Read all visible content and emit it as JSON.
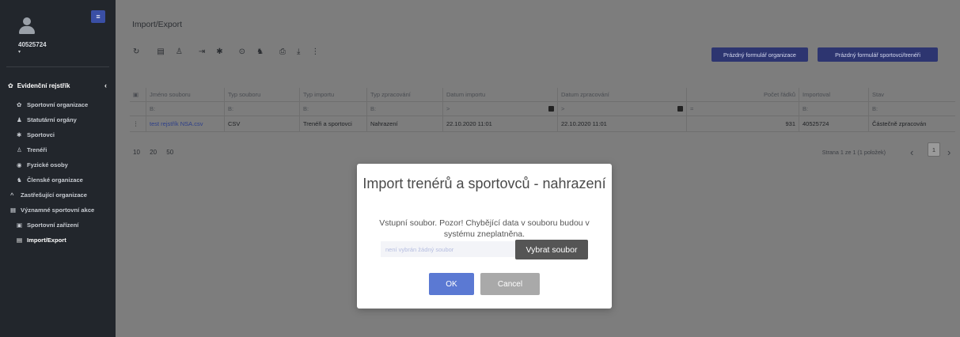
{
  "user": {
    "id": "40525724",
    "caret": "▾"
  },
  "sidebar": {
    "menu_icon": "≡",
    "section": {
      "label": "Evidenční rejstřík",
      "icon": "gear-icon",
      "chevron": "‹"
    },
    "items": [
      {
        "label": "Sportovní organizace",
        "icon": "gear-icon"
      },
      {
        "label": "Statutární orgány",
        "icon": "user-tie-icon"
      },
      {
        "label": "Sportovci",
        "icon": "runner-icon"
      },
      {
        "label": "Trenéři",
        "icon": "trainer-icon"
      },
      {
        "label": "Fyzické osoby",
        "icon": "person-circle-icon"
      },
      {
        "label": "Členské organizace",
        "icon": "users-icon"
      },
      {
        "label": "Zastřešující organizace",
        "icon": "chevron-up-icon"
      },
      {
        "label": "Významné sportovní akce",
        "icon": "calendar-icon"
      },
      {
        "label": "Sportovní zařízení",
        "icon": "building-icon"
      },
      {
        "label": "Import/Export",
        "icon": "file-import-icon"
      }
    ]
  },
  "header": {
    "title": "Import/Export"
  },
  "toolbar": {
    "icons": [
      "refresh-icon",
      "file-icon",
      "person-icon",
      "export-icon",
      "runner-icon",
      "help-icon",
      "users-icon",
      "print-icon",
      "download-icon",
      "more-icon"
    ],
    "btn_org": "Prázdný formulář organizace",
    "btn_sport": "Prázdný formulář sportovci/trenéři"
  },
  "table": {
    "headers": [
      "Jméno souboru",
      "Typ souboru",
      "Typ importu",
      "Typ zpracování",
      "Datum importu",
      "Datum zpracování",
      "Počet řádků",
      "Importoval",
      "Stav"
    ],
    "filters": [
      "B:",
      "B:",
      "B:",
      "B:",
      ">",
      ">",
      "=",
      "B:",
      "B:"
    ],
    "rows": [
      {
        "menu": "⋮",
        "file": "test rejstřík NSA.csv",
        "type": "CSV",
        "import_type": "Trenéři a sportovci",
        "processing": "Nahrazení",
        "import_date": "22.10.2020 11:01",
        "proc_date": "22.10.2020 11:01",
        "rows": "931",
        "by": "40525724",
        "status": "Částečně zpracován"
      }
    ]
  },
  "pager": {
    "sizes": "10 20 50",
    "info": "Strana 1 ze 1 (1 položek)",
    "prev": "‹",
    "next": "›",
    "current": "1"
  },
  "modal": {
    "title": "Import trenérů a sportovců - nahrazení",
    "text": "Vstupní soubor. Pozor! Chybějící data v souboru budou v systému zneplatněna.",
    "file_placeholder": "není vybrán žádný soubor",
    "file_button": "Vybrat soubor",
    "ok": "OK",
    "cancel": "Cancel"
  }
}
